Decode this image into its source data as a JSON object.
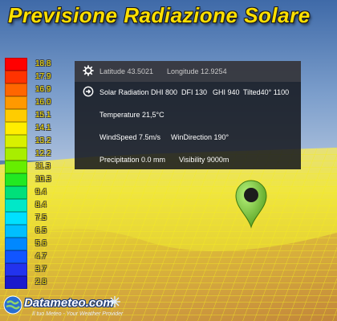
{
  "header": {
    "title": "Previsione Radiazione Solare"
  },
  "legend": {
    "labels": [
      "18.8",
      "17.9",
      "16.9",
      "16.0",
      "15.1",
      "14.1",
      "13.2",
      "12.2",
      "11.3",
      "10.3",
      "9.4",
      "8.4",
      "7.5",
      "6.5",
      "5.6",
      "4.7",
      "3.7",
      "2.8"
    ],
    "colors": [
      "#ff0000",
      "#ff3300",
      "#ff6600",
      "#ff9900",
      "#ffcc00",
      "#ffee00",
      "#d8f000",
      "#a8ee00",
      "#66ee00",
      "#22e822",
      "#00e07a",
      "#00e8c8",
      "#00e0ff",
      "#00bfff",
      "#0088ff",
      "#1155ff",
      "#2233ee",
      "#1a1acc"
    ]
  },
  "info_panel": {
    "latitude": "Latitude 43.5021",
    "longitude": "Longitude 12.9254",
    "solar_radiation": "Solar Radiation DHI 800",
    "dfi": "DFI 130",
    "ghi": "GHI 940",
    "tilted": "Tilted40° 1100",
    "temperature": "Temperature 21,5°C",
    "wind_speed": "WindSpeed 7.5m/s",
    "wind_direction": "WinDirection 190°",
    "precipitation": "Precipitation 0.0 mm",
    "visibility": "Visibility 9000m"
  },
  "brand": {
    "name": "Datameteo.com",
    "tagline": "Il tuo Meteo - Your Weather Provider"
  }
}
